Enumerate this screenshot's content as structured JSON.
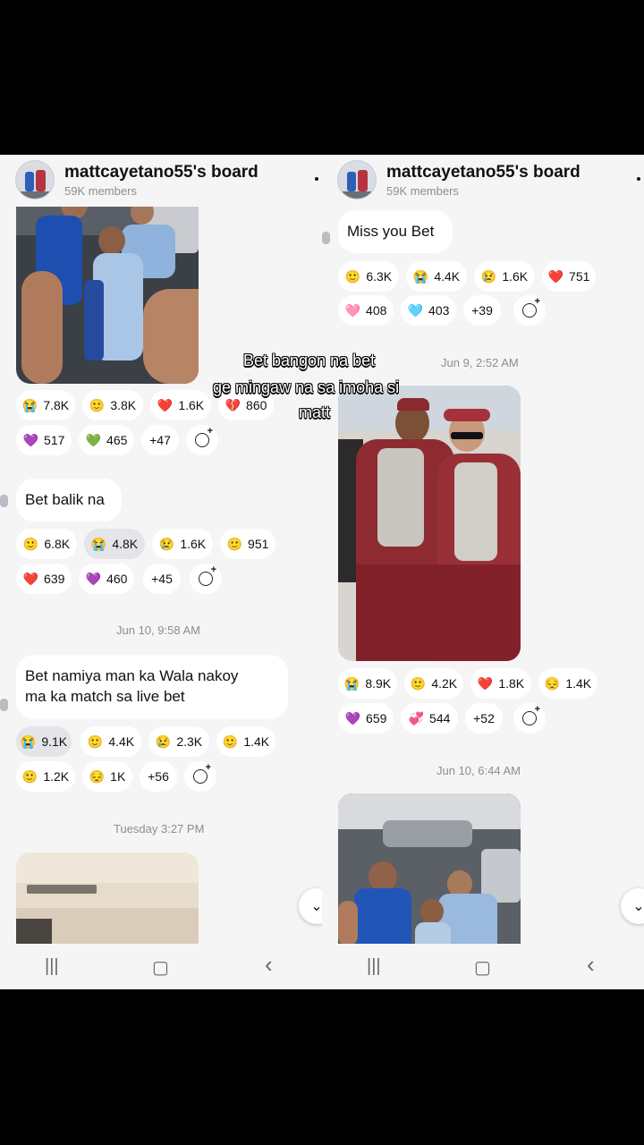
{
  "board": {
    "title": "mattcayetano55's board",
    "members": "59K members"
  },
  "left": {
    "r1": [
      "7.8K",
      "3.8K",
      "1.6K",
      "860"
    ],
    "r2": [
      "517",
      "465",
      "+47"
    ],
    "msg1": "Bet balik na",
    "r3": [
      "6.8K",
      "4.8K",
      "1.6K",
      "951"
    ],
    "r4": [
      "639",
      "460",
      "+45"
    ],
    "date1": "Jun 10, 9:58 AM",
    "msg2_l1": "Bet namiya man ka Wala nakoy",
    "msg2_l2": "ma ka match sa live bet",
    "r5": [
      "9.1K",
      "4.4K",
      "2.3K",
      "1.4K"
    ],
    "r6": [
      "1.2K",
      "1K",
      "+56"
    ],
    "date2": "Tuesday 3:27 PM"
  },
  "right": {
    "msg1": "Miss you Bet",
    "r1": [
      "6.3K",
      "4.4K",
      "1.6K",
      "751"
    ],
    "r2": [
      "408",
      "403",
      "+39"
    ],
    "date1": "Jun 9, 2:52 AM",
    "r3": [
      "8.9K",
      "4.2K",
      "1.8K",
      "1.4K"
    ],
    "r4": [
      "659",
      "544",
      "+52"
    ],
    "date2": "Jun 10, 6:44 AM"
  },
  "caption": {
    "l1": "Bet bangon na bet",
    "l2": "ge mingaw na sa imoha si",
    "l3": "matt"
  },
  "emoji": {
    "cry": "😭",
    "smile": "🙂",
    "sad": "😢",
    "pensive": "😔",
    "heart": "❤️",
    "broken": "💔",
    "purple": "💜",
    "green": "💚",
    "pink": "🩷",
    "blue": "🩵",
    "twohearts": "💞"
  },
  "icons": {
    "nav_recent": "|||",
    "nav_home": "▢",
    "nav_back": "‹",
    "scroll_down": "⌄"
  }
}
